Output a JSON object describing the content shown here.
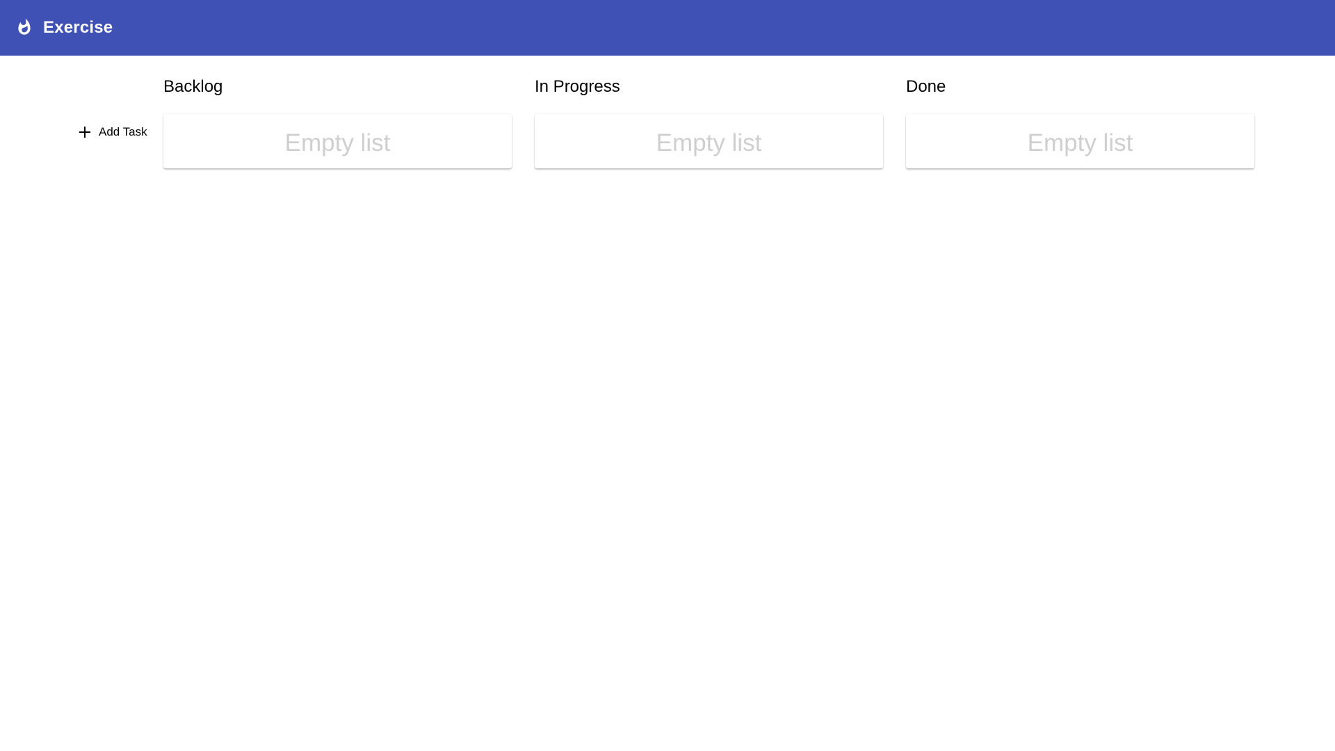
{
  "app": {
    "title": "Exercise",
    "icon": "flame-icon",
    "toolbar_color": "#3f51b5"
  },
  "actions": {
    "add_task_label": "Add Task",
    "add_task_icon": "plus-icon"
  },
  "columns": [
    {
      "title": "Backlog",
      "empty_text": "Empty list"
    },
    {
      "title": "In Progress",
      "empty_text": "Empty list"
    },
    {
      "title": "Done",
      "empty_text": "Empty list"
    }
  ]
}
